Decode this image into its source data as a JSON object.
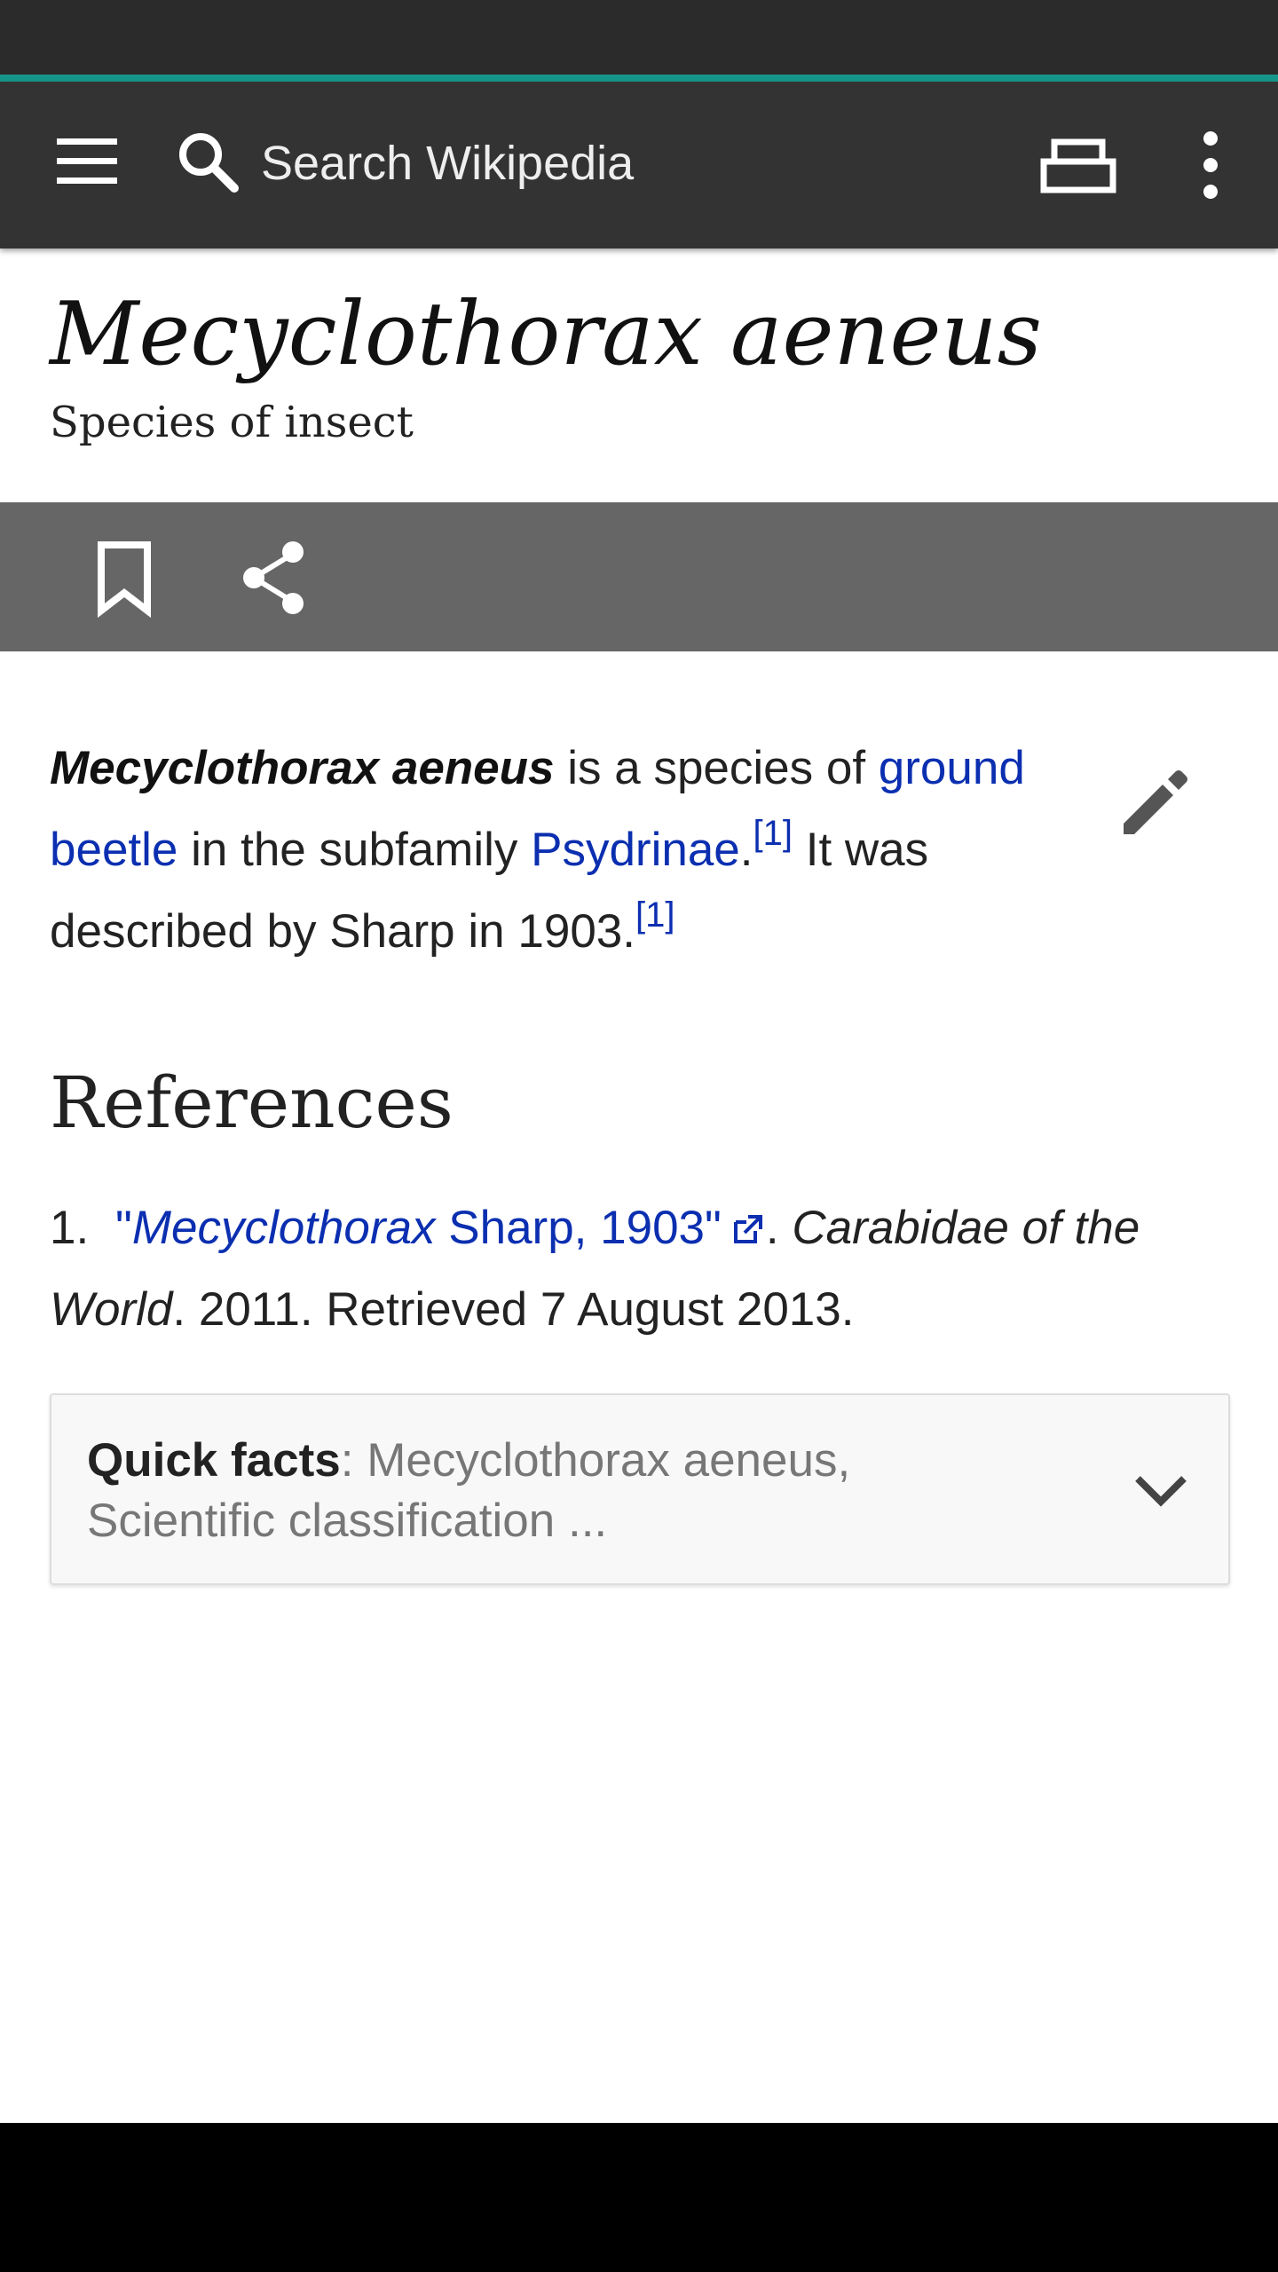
{
  "colors": {
    "status_bar": "#2b2b2b",
    "accent": "#17978a",
    "app_bar": "#333333",
    "action_bar": "#666666",
    "link": "#0b2fb0",
    "nav_bar": "#000000"
  },
  "app_bar": {
    "menu_icon": "menu-icon",
    "search_placeholder": "Search Wikipedia",
    "search_icon": "search-icon",
    "tabs_icon": "tabs-icon",
    "overflow_icon": "more-vertical-icon"
  },
  "article": {
    "title": "Mecyclothorax aeneus",
    "subtitle": "Species of insect",
    "actions": {
      "bookmark_icon": "bookmark-icon",
      "share_icon": "share-icon"
    },
    "lead": {
      "subject": "Mecyclothorax aeneus",
      "text_1": " is a species of ",
      "link_1": "ground beetle",
      "text_2": " in the subfamily ",
      "link_2": "Psydrinae",
      "text_3": ".",
      "cite_1": "[1]",
      "text_4": " It was described by Sharp in 1903.",
      "cite_2": "[1]"
    },
    "edit_icon": "pencil-icon"
  },
  "references": {
    "heading": "References",
    "items": [
      {
        "number": "1.",
        "link_italic": "Mecyclothorax",
        "link_rest": " Sharp, 1903",
        "quote_open": "\"",
        "quote_close": "\"",
        "period": ". ",
        "source_italic": "Carabidae of the World",
        "rest": ". 2011. Retrieved 7 August 2013."
      }
    ]
  },
  "quick_facts": {
    "label": "Quick facts",
    "separator": ": ",
    "summary": "Mecyclothorax aeneus, Scientific classification ...",
    "toggle_icon": "chevron-down-icon"
  }
}
